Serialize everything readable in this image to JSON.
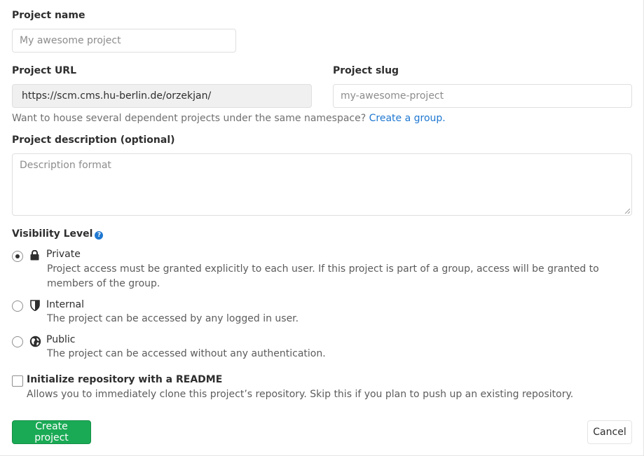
{
  "project_name": {
    "label": "Project name",
    "placeholder": "My awesome project",
    "value": ""
  },
  "project_url": {
    "label": "Project URL",
    "value": "https://scm.cms.hu-berlin.de/orzekjan/"
  },
  "project_slug": {
    "label": "Project slug",
    "placeholder": "my-awesome-project",
    "value": ""
  },
  "namespace_help": {
    "text": "Want to house several dependent projects under the same namespace?",
    "link_text": "Create a group."
  },
  "description": {
    "label": "Project description (optional)",
    "placeholder": "Description format"
  },
  "visibility": {
    "label": "Visibility Level",
    "help_icon": "question-circle-icon",
    "selected": "private",
    "options": [
      {
        "id": "private",
        "icon": "lock-icon",
        "title": "Private",
        "description": "Project access must be granted explicitly to each user. If this project is part of a group, access will be granted to members of the group."
      },
      {
        "id": "internal",
        "icon": "shield-icon",
        "title": "Internal",
        "description": "The project can be accessed by any logged in user."
      },
      {
        "id": "public",
        "icon": "globe-icon",
        "title": "Public",
        "description": "The project can be accessed without any authentication."
      }
    ]
  },
  "readme": {
    "label": "Initialize repository with a README",
    "description": "Allows you to immediately clone this project’s repository. Skip this if you plan to push up an existing repository.",
    "checked": false
  },
  "actions": {
    "create_label": "Create project",
    "cancel_label": "Cancel"
  },
  "colors": {
    "primary_button": "#1aaa55",
    "link": "#1f78d1",
    "readonly_bg": "#f0f0f0"
  }
}
